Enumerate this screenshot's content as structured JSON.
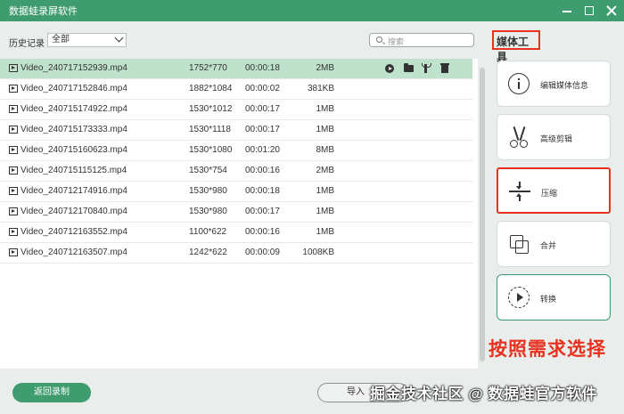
{
  "window": {
    "title": "数据蛙录屏软件"
  },
  "toolbar": {
    "history_label": "历史记录",
    "history_select_value": "全部",
    "search_placeholder": "搜索"
  },
  "files": [
    {
      "name": "Video_240717152939.mp4",
      "resolution": "1752*770",
      "duration": "00:00:18",
      "size": "2MB",
      "selected": true
    },
    {
      "name": "Video_240717152846.mp4",
      "resolution": "1882*1084",
      "duration": "00:00:02",
      "size": "381KB"
    },
    {
      "name": "Video_240715174922.mp4",
      "resolution": "1530*1012",
      "duration": "00:00:17",
      "size": "1MB"
    },
    {
      "name": "Video_240715173333.mp4",
      "resolution": "1530*1118",
      "duration": "00:00:17",
      "size": "1MB"
    },
    {
      "name": "Video_240715160623.mp4",
      "resolution": "1530*1080",
      "duration": "00:01:20",
      "size": "8MB"
    },
    {
      "name": "Video_240715115125.mp4",
      "resolution": "1530*754",
      "duration": "00:00:16",
      "size": "2MB"
    },
    {
      "name": "Video_240712174916.mp4",
      "resolution": "1530*980",
      "duration": "00:00:18",
      "size": "1MB"
    },
    {
      "name": "Video_240712170840.mp4",
      "resolution": "1530*980",
      "duration": "00:00:17",
      "size": "1MB"
    },
    {
      "name": "Video_240712163552.mp4",
      "resolution": "1100*622",
      "duration": "00:00:16",
      "size": "1MB"
    },
    {
      "name": "Video_240712163507.mp4",
      "resolution": "1242*622",
      "duration": "00:00:09",
      "size": "1008KB"
    }
  ],
  "media_tools": {
    "title": "媒体工具",
    "items": [
      {
        "label": "编辑媒体信息",
        "icon": "info-icon"
      },
      {
        "label": "高级剪辑",
        "icon": "scissors-icon"
      },
      {
        "label": "压缩",
        "icon": "compress-icon"
      },
      {
        "label": "合并",
        "icon": "merge-icon"
      },
      {
        "label": "转换",
        "icon": "convert-icon"
      }
    ]
  },
  "annotation": "按照需求选择",
  "footer": {
    "back_label": "返回录制",
    "import_label": "导入"
  },
  "watermark": "掘金技术社区 @ 数据蛙官方软件",
  "colors": {
    "brand_green": "#3f9c6f",
    "selected_row": "#bfe2cd",
    "annotation_red": "#e8311f"
  }
}
